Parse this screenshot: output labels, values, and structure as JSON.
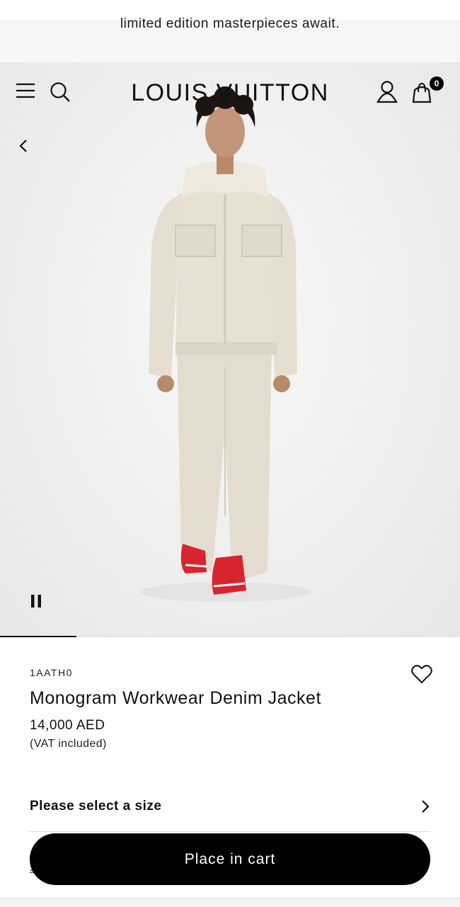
{
  "banner": {
    "text": "limited edition masterpieces await."
  },
  "header": {
    "logo": "LOUIS VUITTON",
    "bag_count": "0",
    "icons": [
      "menu-icon",
      "search-icon",
      "account-icon",
      "shopping-bag-icon"
    ]
  },
  "gallery": {
    "progress": 0.166,
    "icons": [
      "chevron-left-icon",
      "pause-icon"
    ]
  },
  "product": {
    "reference": "1AATH0",
    "name": "Monogram Workwear Denim Jacket",
    "price": "14,000 AED",
    "vat": "(VAT included)",
    "size_prompt": "Please select a size",
    "obscured_link": "S"
  },
  "cta": {
    "label": "Place in cart"
  },
  "colors": {
    "accent": "#000000",
    "background": "#ffffff",
    "banner_bg": "#f6f6f6",
    "sneaker_red": "#d9242f"
  }
}
